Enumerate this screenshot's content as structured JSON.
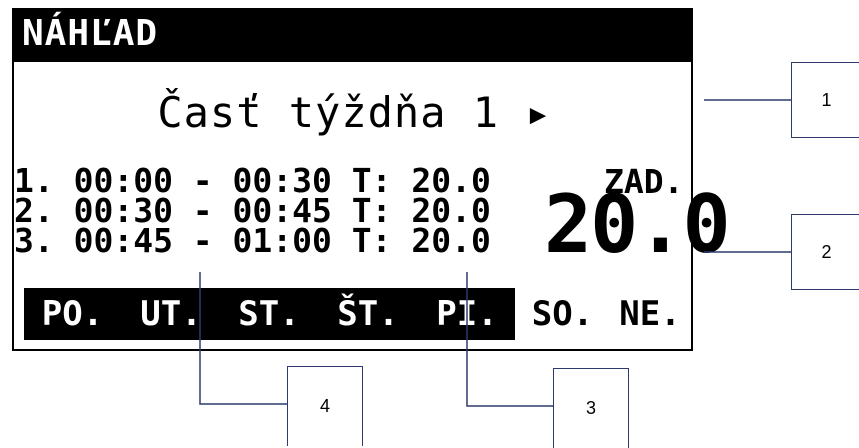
{
  "screen": {
    "title": "NÁHĽAD",
    "part_label": "Časť týždňa 1 ▸",
    "program_rows": [
      "1. 00:00 - 00:30 T: 20.0",
      "2. 00:30 - 00:45 T: 20.0",
      "3. 00:45 - 01:00 T: 20.0"
    ],
    "setpoint_label": "ZAD.",
    "setpoint_value": "20.0",
    "days": [
      {
        "label": "PO.",
        "active": true
      },
      {
        "label": "UT.",
        "active": true
      },
      {
        "label": "ST.",
        "active": true
      },
      {
        "label": "ŠT.",
        "active": true
      },
      {
        "label": "PI.",
        "active": true
      },
      {
        "label": "SO.",
        "active": false
      },
      {
        "label": "NE.",
        "active": false
      }
    ]
  },
  "callouts": {
    "c1": "1",
    "c2": "2",
    "c3": "3",
    "c4": "4"
  },
  "colors": {
    "lcd_fg": "#000000",
    "lcd_bg": "#ffffff",
    "callout_line": "#2e3a6e"
  }
}
